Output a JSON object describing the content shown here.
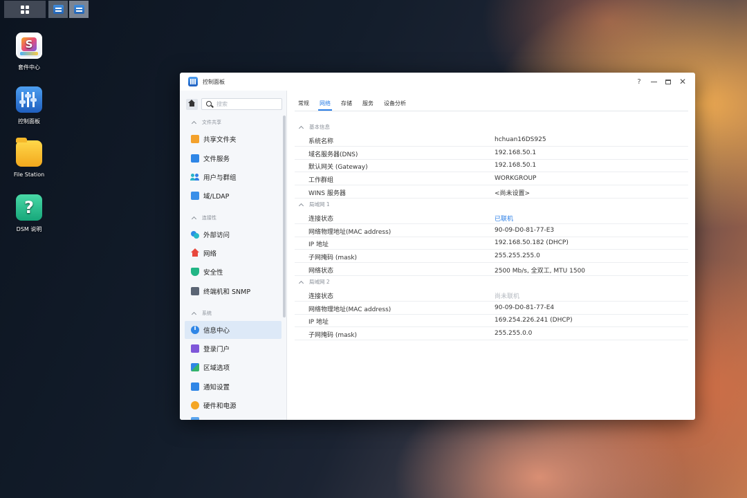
{
  "desktop": {
    "icons": [
      {
        "label": "套件中心"
      },
      {
        "label": "控制面板"
      },
      {
        "label": "File Station"
      },
      {
        "label": "DSM 说明"
      }
    ]
  },
  "window": {
    "title": "控制面板",
    "help": "?",
    "close": "✕"
  },
  "sidebar": {
    "search_placeholder": "搜索",
    "sections": [
      {
        "label": "文件共享",
        "items": [
          {
            "label": "共享文件夹",
            "icon": "shared-folder-icon"
          },
          {
            "label": "文件服务",
            "icon": "file-services-icon"
          },
          {
            "label": "用户与群组",
            "icon": "users-groups-icon"
          },
          {
            "label": "域/LDAP",
            "icon": "domain-ldap-icon"
          }
        ]
      },
      {
        "label": "连接性",
        "items": [
          {
            "label": "外部访问",
            "icon": "external-access-icon"
          },
          {
            "label": "网络",
            "icon": "network-icon"
          },
          {
            "label": "安全性",
            "icon": "security-shield-icon"
          },
          {
            "label": "终端机和 SNMP",
            "icon": "terminal-icon"
          }
        ]
      },
      {
        "label": "系统",
        "items": [
          {
            "label": "信息中心",
            "icon": "info-icon",
            "active": true
          },
          {
            "label": "登录门户",
            "icon": "login-portal-icon"
          },
          {
            "label": "区域选项",
            "icon": "regional-options-icon"
          },
          {
            "label": "通知设置",
            "icon": "notification-icon"
          },
          {
            "label": "硬件和电源",
            "icon": "hardware-power-icon"
          }
        ]
      }
    ]
  },
  "tabs": [
    {
      "label": "常规"
    },
    {
      "label": "网络",
      "active": true
    },
    {
      "label": "存储"
    },
    {
      "label": "服务"
    },
    {
      "label": "设备分析"
    }
  ],
  "groups": [
    {
      "label": "基本信息",
      "rows": [
        {
          "key": "系统名称",
          "value": "hchuan16DS925"
        },
        {
          "key": "域名服务器(DNS)",
          "value": "192.168.50.1"
        },
        {
          "key": "默认网关 (Gateway)",
          "value": "192.168.50.1"
        },
        {
          "key": "工作群组",
          "value": "WORKGROUP"
        },
        {
          "key": "WINS 服务器",
          "value": "<尚未设置>"
        }
      ]
    },
    {
      "label": "局域网 1",
      "rows": [
        {
          "key": "连接状态",
          "value": "已联机",
          "status_color": "#2a7ee6"
        },
        {
          "key": "网络物理地址(MAC address)",
          "value": "90-09-D0-81-77-E3"
        },
        {
          "key": "IP 地址",
          "value": "192.168.50.182 (DHCP)"
        },
        {
          "key": "子网掩码 (mask)",
          "value": "255.255.255.0"
        },
        {
          "key": "网络状态",
          "value": "2500 Mb/s, 全双工, MTU 1500"
        }
      ]
    },
    {
      "label": "局域网 2",
      "rows": [
        {
          "key": "连接状态",
          "value": "尚未联机",
          "status_color": "#b3b8bf"
        },
        {
          "key": "网络物理地址(MAC address)",
          "value": "90-09-D0-81-77-E4"
        },
        {
          "key": "IP 地址",
          "value": "169.254.226.241 (DHCP)"
        },
        {
          "key": "子网掩码 (mask)",
          "value": "255.255.0.0"
        }
      ]
    }
  ],
  "colors": {
    "accent": "#2a7ee6",
    "active_bg": "#dde9f7"
  }
}
